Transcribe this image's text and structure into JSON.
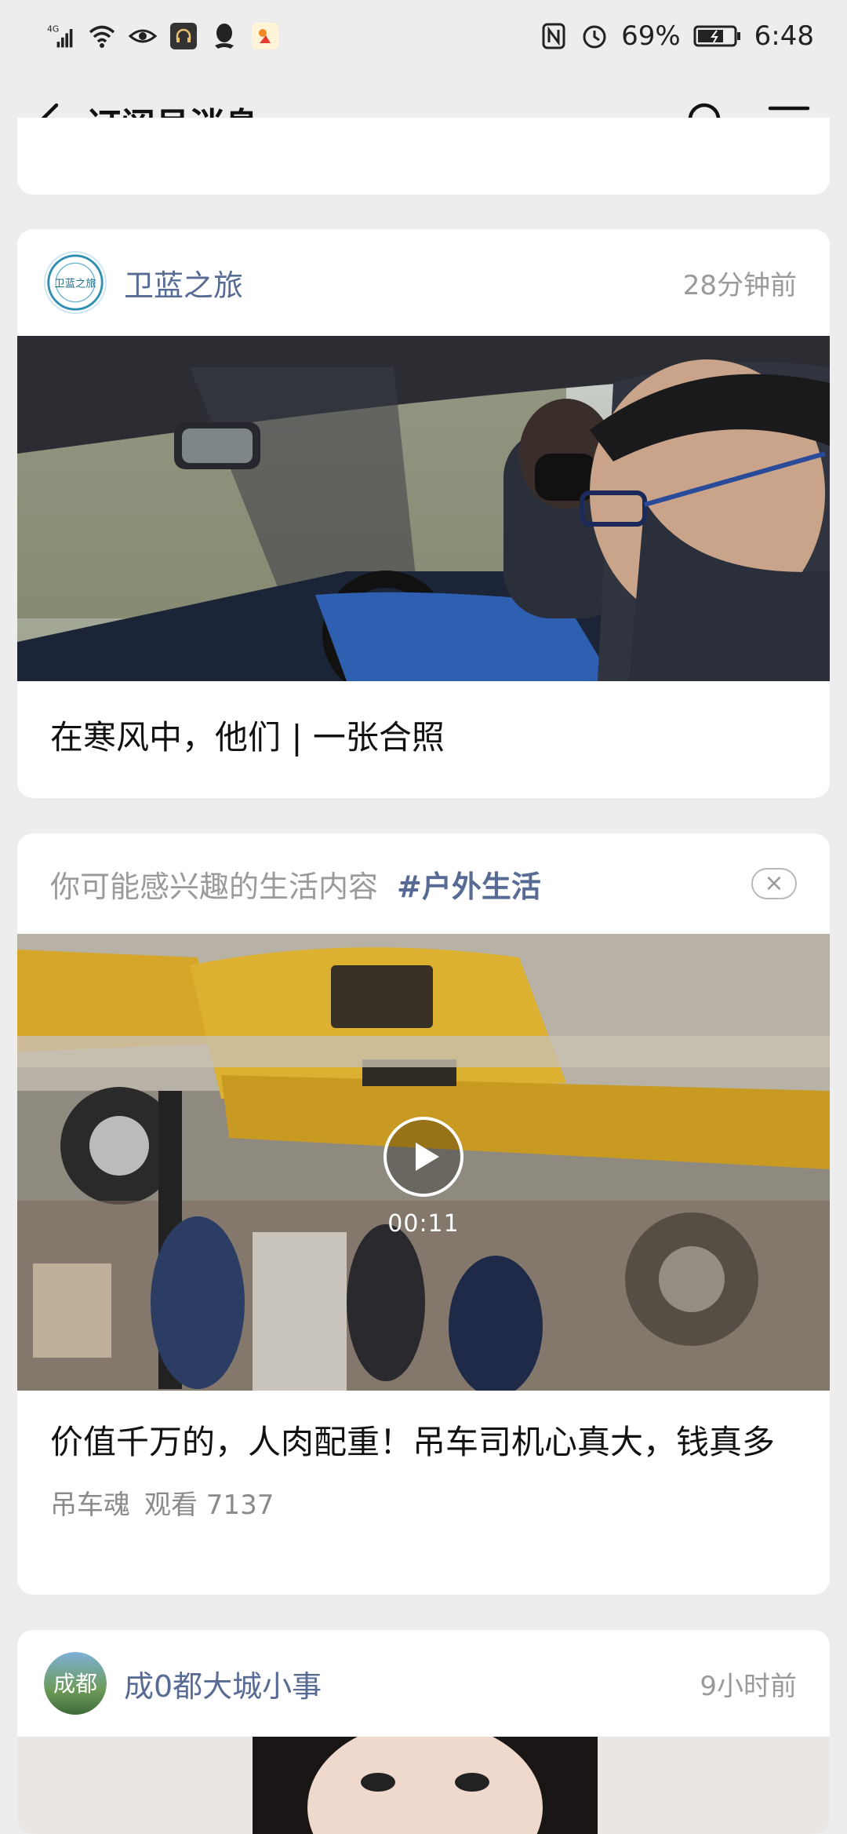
{
  "status_bar": {
    "network": "4G",
    "battery_percent": "69%",
    "time": "6:48"
  },
  "nav": {
    "title": "订阅号消息"
  },
  "cards": [
    {
      "account": "卫蓝之旅",
      "avatar_text": "卫蓝之旅",
      "time": "28分钟前",
      "title": "在寒风中，他们 | 一张合照"
    },
    {
      "rec_label": "你可能感兴趣的生活内容",
      "rec_tag": "#户外生活",
      "close_symbol": "×",
      "duration": "00:11",
      "title": "价值千万的，人肉配重！吊车司机心真大，钱真多",
      "source": "吊车魂",
      "views": "观看 7137"
    },
    {
      "account": "成0都大城小事",
      "avatar_text": "成都",
      "time": "9小时前"
    }
  ]
}
